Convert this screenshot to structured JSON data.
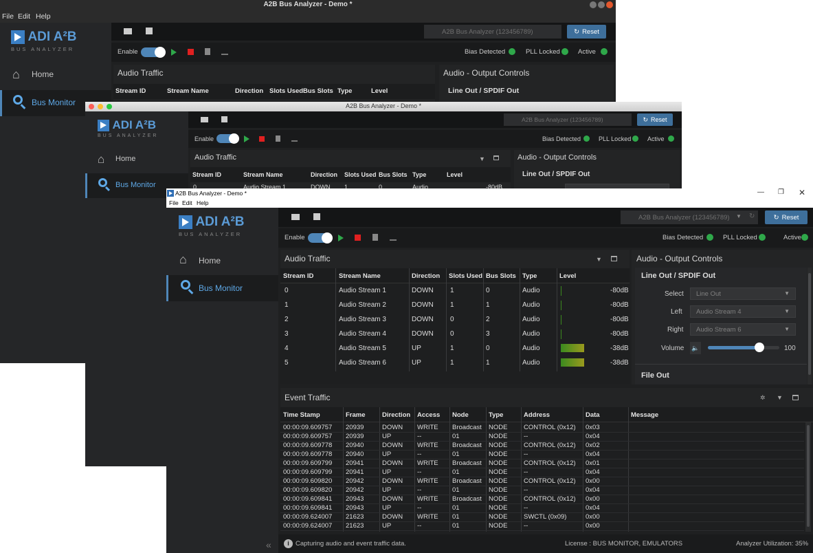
{
  "windows": {
    "back": {
      "title": "A2B Bus Analyzer - Demo *",
      "menu": [
        "File",
        "Edit",
        "Help"
      ],
      "logo_text": "ADI A²B",
      "logo_sub": "BUS ANALYZER",
      "nav": [
        "Home",
        "Bus Monitor"
      ],
      "device": "A2B Bus Analyzer (123456789)",
      "reset": "Reset",
      "enable": "Enable",
      "status": [
        "Bias Detected",
        "PLL Locked",
        "Active"
      ],
      "audio_traffic": "Audio Traffic",
      "output_controls": "Audio - Output Controls",
      "line_out": "Line Out / SPDIF Out",
      "columns": [
        "Stream ID",
        "Stream Name",
        "Direction",
        "Slots Used",
        "Bus Slots",
        "Type",
        "Level"
      ]
    },
    "middle": {
      "title": "A2B Bus Analyzer - Demo *",
      "row_peek": [
        "0",
        "Audio Stream 1",
        "DOWN",
        "1",
        "0",
        "Audio",
        "-80dB"
      ]
    },
    "front": {
      "title": "A2B Bus Analyzer - Demo *",
      "menu": [
        "File",
        "Edit",
        "Help"
      ],
      "window_controls": [
        "—",
        "❐",
        "✕"
      ]
    }
  },
  "audio_rows": [
    {
      "id": "0",
      "name": "Audio Stream 1",
      "dir": "DOWN",
      "used": "1",
      "bus": "0",
      "type": "Audio",
      "level": "-80dB",
      "level_fill": 0.02
    },
    {
      "id": "1",
      "name": "Audio Stream 2",
      "dir": "DOWN",
      "used": "1",
      "bus": "1",
      "type": "Audio",
      "level": "-80dB",
      "level_fill": 0.02
    },
    {
      "id": "2",
      "name": "Audio Stream 3",
      "dir": "DOWN",
      "used": "0",
      "bus": "2",
      "type": "Audio",
      "level": "-80dB",
      "level_fill": 0.02
    },
    {
      "id": "3",
      "name": "Audio Stream 4",
      "dir": "DOWN",
      "used": "0",
      "bus": "3",
      "type": "Audio",
      "level": "-80dB",
      "level_fill": 0.02
    },
    {
      "id": "4",
      "name": "Audio Stream 5",
      "dir": "UP",
      "used": "1",
      "bus": "0",
      "type": "Audio",
      "level": "-38dB",
      "level_fill": 0.38
    },
    {
      "id": "5",
      "name": "Audio Stream 6",
      "dir": "UP",
      "used": "1",
      "bus": "1",
      "type": "Audio",
      "level": "-38dB",
      "level_fill": 0.38
    }
  ],
  "output": {
    "select_label": "Select",
    "select_value": "Line Out",
    "left_label": "Left",
    "left_value": "Audio Stream 4",
    "right_label": "Right",
    "right_value": "Audio Stream 6",
    "volume_label": "Volume",
    "volume_value": "100",
    "volume_fill": 0.72,
    "file_out": "File Out"
  },
  "event_traffic": {
    "title": "Event Traffic",
    "columns": [
      "Time Stamp",
      "Frame",
      "Direction",
      "Access",
      "Node",
      "Type",
      "Address",
      "Data",
      "Message"
    ],
    "rows": [
      [
        "00:00:09.609757",
        "20939",
        "DOWN",
        "WRITE",
        "Broadcast",
        "NODE",
        "CONTROL (0x12)",
        "0x03",
        ""
      ],
      [
        "00:00:09.609757",
        "20939",
        "UP",
        "--",
        "01",
        "NODE",
        "--",
        "0x04",
        ""
      ],
      [
        "00:00:09.609778",
        "20940",
        "DOWN",
        "WRITE",
        "Broadcast",
        "NODE",
        "CONTROL (0x12)",
        "0x02",
        ""
      ],
      [
        "00:00:09.609778",
        "20940",
        "UP",
        "--",
        "01",
        "NODE",
        "--",
        "0x04",
        ""
      ],
      [
        "00:00:09.609799",
        "20941",
        "DOWN",
        "WRITE",
        "Broadcast",
        "NODE",
        "CONTROL (0x12)",
        "0x01",
        ""
      ],
      [
        "00:00:09.609799",
        "20941",
        "UP",
        "--",
        "01",
        "NODE",
        "--",
        "0x04",
        ""
      ],
      [
        "00:00:09.609820",
        "20942",
        "DOWN",
        "WRITE",
        "Broadcast",
        "NODE",
        "CONTROL (0x12)",
        "0x00",
        ""
      ],
      [
        "00:00:09.609820",
        "20942",
        "UP",
        "--",
        "01",
        "NODE",
        "--",
        "0x04",
        ""
      ],
      [
        "00:00:09.609841",
        "20943",
        "DOWN",
        "WRITE",
        "Broadcast",
        "NODE",
        "CONTROL (0x12)",
        "0x00",
        ""
      ],
      [
        "00:00:09.609841",
        "20943",
        "UP",
        "--",
        "01",
        "NODE",
        "--",
        "0x04",
        ""
      ],
      [
        "00:00:09.624007",
        "21623",
        "DOWN",
        "WRITE",
        "01",
        "NODE",
        "SWCTL (0x09)",
        "0x00",
        ""
      ],
      [
        "00:00:09.624007",
        "21623",
        "UP",
        "--",
        "01",
        "NODE",
        "--",
        "0x00",
        ""
      ]
    ]
  },
  "statusbar": {
    "message": "Capturing audio and event traffic data.",
    "license": "License : BUS MONITOR, EMULATORS",
    "utilization": "Analyzer Utilization: 35%"
  },
  "colors": {
    "accent": "#4f86b8",
    "led": "#2fa84a",
    "stop": "#e02020",
    "reset": "#3e6f9b"
  }
}
